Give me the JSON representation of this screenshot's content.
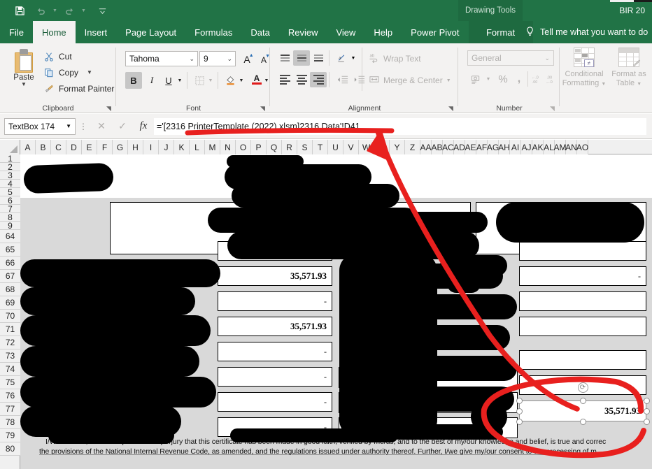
{
  "app": {
    "title": "BIR 20",
    "contextual_tools_label": "Drawing Tools",
    "quick_access": [
      {
        "name": "save-icon",
        "label": "Save"
      },
      {
        "name": "undo-icon",
        "label": "Undo"
      },
      {
        "name": "redo-icon",
        "label": "Redo"
      },
      {
        "name": "customize-quick-access-icon",
        "label": "Customize Quick Access Toolbar"
      }
    ]
  },
  "tabs": [
    {
      "label": "File",
      "active": false
    },
    {
      "label": "Home",
      "active": true
    },
    {
      "label": "Insert",
      "active": false
    },
    {
      "label": "Page Layout",
      "active": false
    },
    {
      "label": "Formulas",
      "active": false
    },
    {
      "label": "Data",
      "active": false
    },
    {
      "label": "Review",
      "active": false
    },
    {
      "label": "View",
      "active": false
    },
    {
      "label": "Help",
      "active": false
    },
    {
      "label": "Power Pivot",
      "active": false
    }
  ],
  "contextual_tab": {
    "label": "Format"
  },
  "tell_me": {
    "label": "Tell me what you want to do",
    "icon": "lightbulb-icon"
  },
  "ribbon": {
    "clipboard": {
      "title": "Clipboard",
      "paste": "Paste",
      "cut": "Cut",
      "copy": "Copy",
      "format_painter": "Format Painter"
    },
    "font": {
      "title": "Font",
      "family": "Tahoma",
      "size": "9",
      "bold": "B",
      "italic": "I",
      "underline": "U",
      "grow": "A",
      "shrink": "A",
      "fill_color": "A",
      "font_color": "A",
      "bold_active": true
    },
    "alignment": {
      "title": "Alignment",
      "wrap_text": "Wrap Text",
      "merge_center": "Merge & Center"
    },
    "number": {
      "title": "Number",
      "format": "General",
      "percent": "%",
      "comma": ","
    },
    "styles": {
      "conditional_formatting": "Conditional Formatting",
      "format_as_table": "Format as Table"
    }
  },
  "formula_bar": {
    "name_box": "TextBox 174",
    "formula": "='[2316 PrinterTemplate (2022).xlsm]2316 Data'!D41",
    "cancel_icon": "close-icon",
    "confirm_icon": "check-icon",
    "function_icon": "fx-icon"
  },
  "grid": {
    "columns": [
      "A",
      "B",
      "C",
      "D",
      "E",
      "F",
      "G",
      "H",
      "I",
      "J",
      "K",
      "L",
      "M",
      "N",
      "O",
      "P",
      "Q",
      "R",
      "S",
      "T",
      "U",
      "V",
      "W",
      "X",
      "Y",
      "Z",
      "AA",
      "AB",
      "AC",
      "AD",
      "AE",
      "AF",
      "AG",
      "AH",
      "AI",
      "AJ",
      "AK",
      "AL",
      "AM",
      "AN",
      "AO"
    ],
    "rows": [
      "1",
      "2",
      "3",
      "4",
      "5",
      "6",
      "7",
      "8",
      "9",
      "64",
      "65",
      "66",
      "67",
      "68",
      "69",
      "70",
      "71",
      "72",
      "73",
      "74",
      "75",
      "76",
      "77",
      "78",
      "79",
      "80"
    ]
  },
  "form": {
    "values": {
      "v1": "35,571.93",
      "v2": "-",
      "v3": "35,571.93",
      "v4": "-",
      "v5": "-",
      "v6": "-",
      "v7": "-",
      "v8": "-",
      "selected": "35,571.93"
    },
    "declaration_line1": "I/We declare, under the penalties of perjury that this certificate has been made in good faith, verified by me/us, and to the best of my/our knowledge and belief, is true and correc",
    "declaration_line2": "the provisions of the National Internal Revenue Code, as amended, and the regulations issued under authority thereof. Further, I/we give my/our consent to the processing of m"
  },
  "selection": {
    "object_name": "TextBox 174",
    "rotation_handle": "rotate-handle"
  },
  "annotation": {
    "color": "#e8201e",
    "shapes": [
      "underline-formula",
      "arrow-to-textbox",
      "circle-around-textbox"
    ]
  }
}
